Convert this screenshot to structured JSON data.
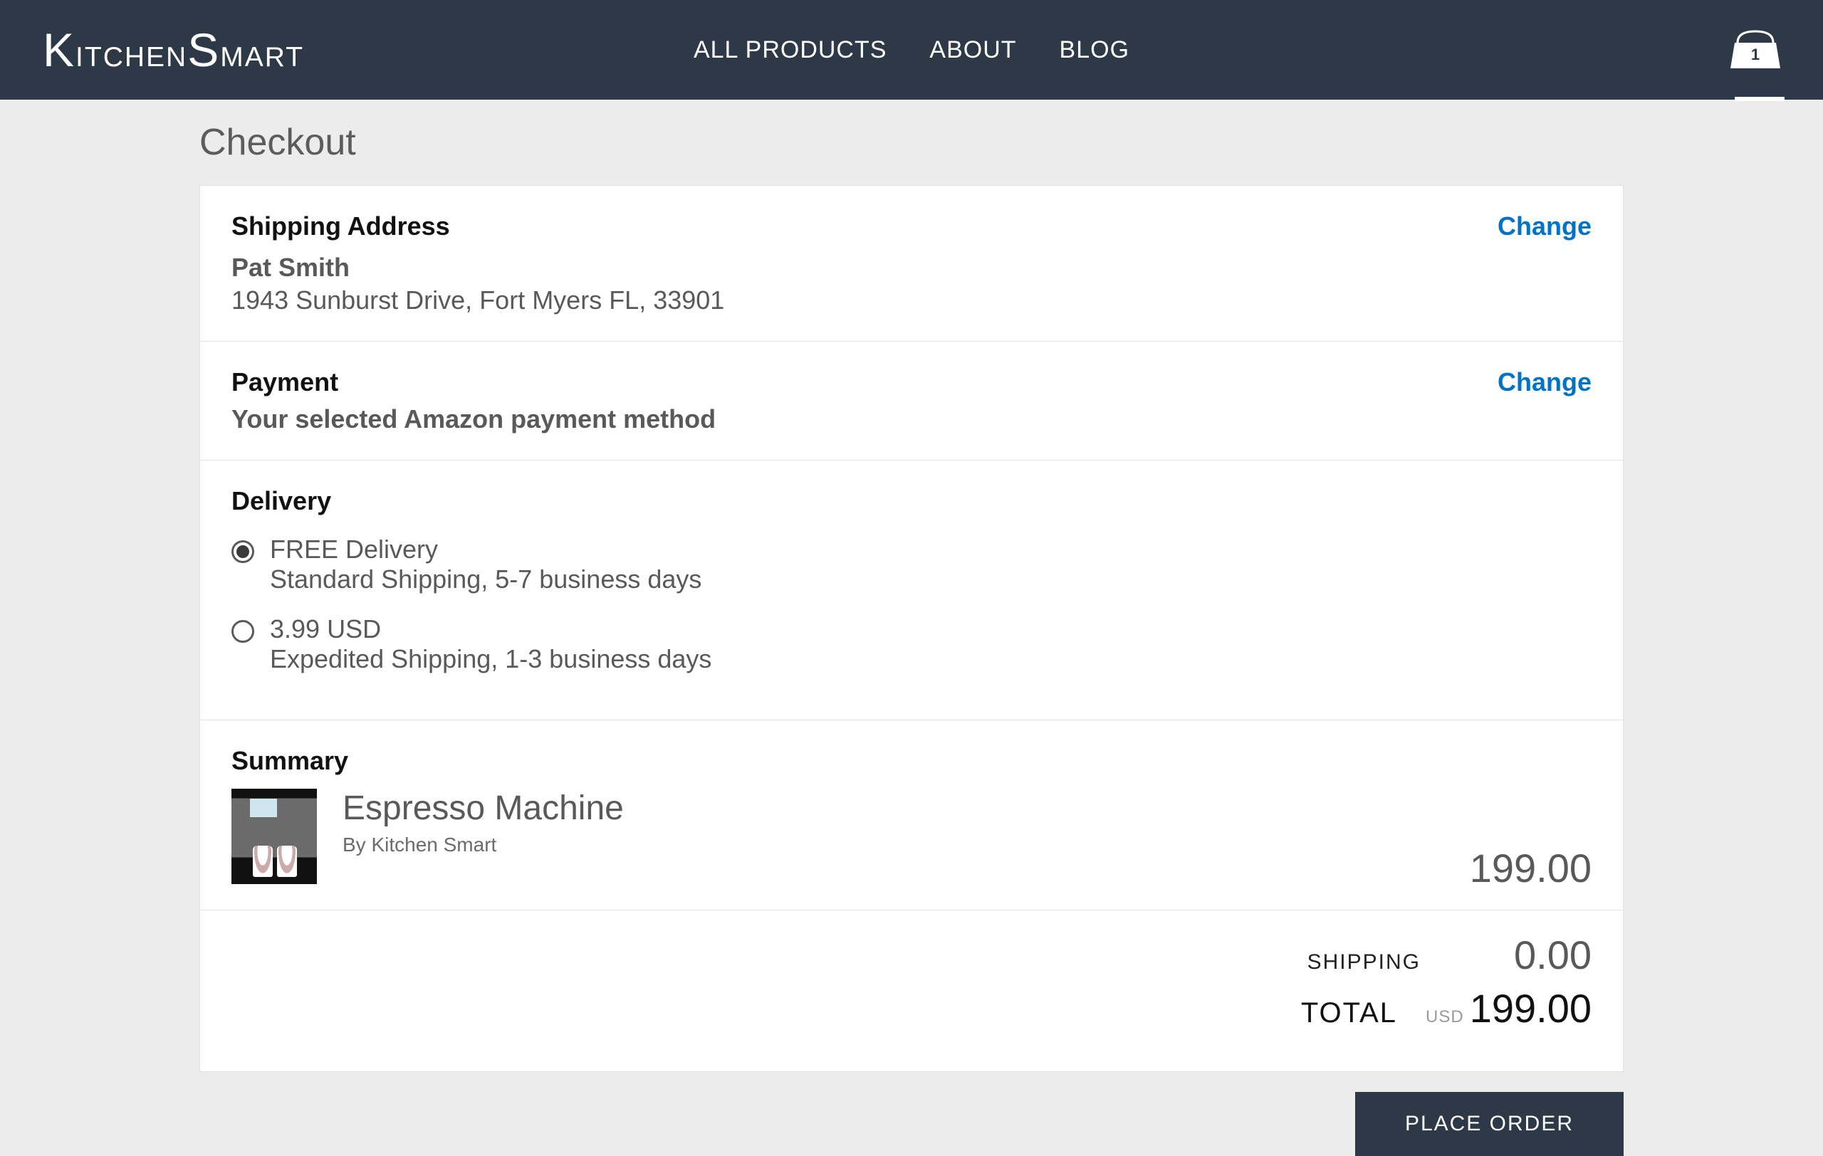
{
  "header": {
    "logo": "KitchenSmart",
    "nav": [
      "ALL PRODUCTS",
      "ABOUT",
      "BLOG"
    ],
    "cart_count": "1"
  },
  "page": {
    "title": "Checkout"
  },
  "shipping": {
    "section_title": "Shipping Address",
    "change": "Change",
    "name": "Pat Smith",
    "address": "1943 Sunburst Drive, Fort Myers FL, 33901"
  },
  "payment": {
    "section_title": "Payment",
    "change": "Change",
    "subtitle": "Your selected Amazon payment method"
  },
  "delivery": {
    "section_title": "Delivery",
    "options": [
      {
        "price": "FREE Delivery",
        "desc": "Standard Shipping, 5-7 business days",
        "selected": true
      },
      {
        "price": "3.99 USD",
        "desc": "Expedited Shipping, 1-3 business days",
        "selected": false
      }
    ]
  },
  "summary": {
    "section_title": "Summary",
    "item": {
      "name": "Espresso Machine",
      "by": "By Kitchen Smart",
      "price": "199.00"
    },
    "shipping_label": "SHIPPING",
    "shipping_value": "0.00",
    "total_label": "TOTAL",
    "currency": "USD",
    "total_value": "199.00"
  },
  "cta": {
    "place_order": "PLACE ORDER"
  }
}
